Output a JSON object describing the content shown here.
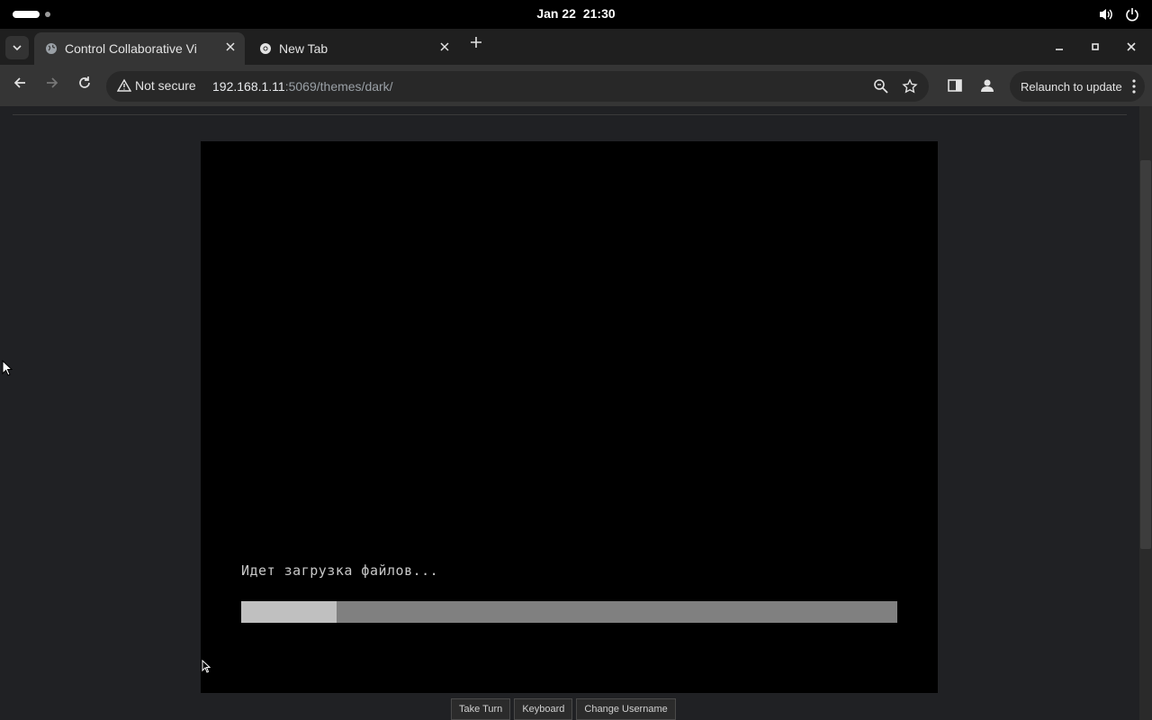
{
  "topbar": {
    "date": "Jan 22",
    "time": "21:30"
  },
  "tabs": [
    {
      "title": "Control Collaborative Vi",
      "active": true,
      "icon": "globe-icon"
    },
    {
      "title": "New Tab",
      "active": false,
      "icon": "chrome-icon"
    }
  ],
  "toolbar": {
    "security_label": "Not secure",
    "url_host": "192.168.1.11",
    "url_rest": ":5069/themes/dark/",
    "relaunch_label": "Relaunch to update"
  },
  "vm": {
    "status_text": "Идет загрузка файлов...",
    "progress_fraction": 0.145
  },
  "controls": {
    "take_turn": "Take Turn",
    "keyboard": "Keyboard",
    "change_username": "Change Username"
  },
  "colors": {
    "page_bg": "#202124",
    "vm_bg": "#000000",
    "progress_track": "#808080",
    "progress_fill": "#c0c0c0"
  }
}
